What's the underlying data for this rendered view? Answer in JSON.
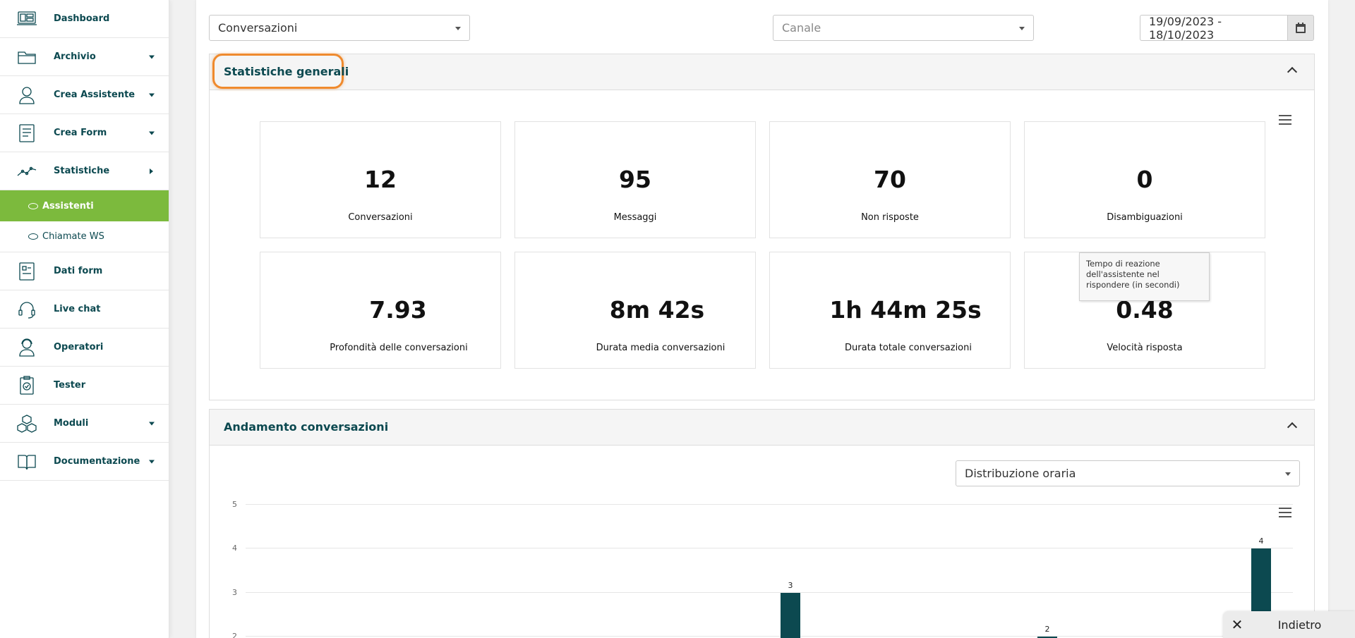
{
  "sidebar": {
    "items": [
      {
        "label": "Dashboard",
        "icon": "monitor-icon",
        "caret": "none"
      },
      {
        "label": "Archivio",
        "icon": "folder-icon",
        "caret": "down"
      },
      {
        "label": "Crea Assistente",
        "icon": "assistant-icon",
        "caret": "down"
      },
      {
        "label": "Crea Form",
        "icon": "form-icon",
        "caret": "down"
      },
      {
        "label": "Statistiche",
        "icon": "chart-line-icon",
        "caret": "right"
      }
    ],
    "subitems": [
      {
        "label": "Assistenti",
        "active": true
      },
      {
        "label": "Chiamate WS",
        "active": false
      }
    ],
    "items2": [
      {
        "label": "Dati form",
        "icon": "form-data-icon",
        "caret": "none"
      },
      {
        "label": "Live chat",
        "icon": "headset-icon",
        "caret": "none"
      },
      {
        "label": "Operatori",
        "icon": "operator-icon",
        "caret": "none"
      },
      {
        "label": "Tester",
        "icon": "clipboard-check-icon",
        "caret": "none"
      },
      {
        "label": "Moduli",
        "icon": "cubes-icon",
        "caret": "down"
      },
      {
        "label": "Documentazione",
        "icon": "book-icon",
        "caret": "down"
      }
    ]
  },
  "filters": {
    "type_select": "Conversazioni",
    "channel_placeholder": "Canale",
    "date_range": "19/09/2023 - 18/10/2023"
  },
  "general_stats": {
    "title": "Statistiche generali",
    "cards": [
      {
        "value": "12",
        "label": "Conversazioni"
      },
      {
        "value": "95",
        "label": "Messaggi"
      },
      {
        "value": "70",
        "label": "Non risposte"
      },
      {
        "value": "0",
        "label": "Disambiguazioni"
      },
      {
        "value": "7.93",
        "label": "Profondità delle conversazioni"
      },
      {
        "value": "8m 42s",
        "label": "Durata media conversazioni"
      },
      {
        "value": "1h 44m 25s",
        "label": "Durata totale conversazioni"
      },
      {
        "value": "0.48",
        "label": "Velocità risposta"
      }
    ],
    "tooltip": "Tempo di reazione dell'assistente nel rispondere (in secondi)"
  },
  "trend": {
    "title": "Andamento conversazioni",
    "distribution_select": "Distribuzione oraria"
  },
  "chart_data": {
    "type": "bar",
    "title": "",
    "xlabel": "",
    "ylabel": "",
    "yticks": [
      2,
      3,
      4,
      5
    ],
    "ylim": [
      0,
      5
    ],
    "values_visible": [
      {
        "index": 0,
        "value": 3
      },
      {
        "index": 1,
        "value": 2
      },
      {
        "index": 2,
        "value": 4
      }
    ],
    "bar_color": "#0c4950",
    "grid": true
  },
  "back_button": {
    "label": "Indietro"
  },
  "colors": {
    "brand": "#0c4950",
    "active": "#7cba3d",
    "highlight": "#ef8a2d"
  }
}
